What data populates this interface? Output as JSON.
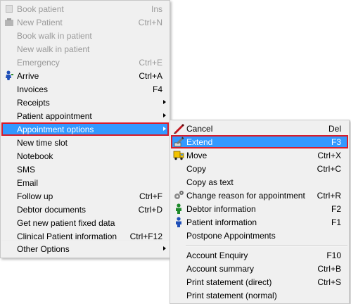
{
  "main_menu": {
    "book_patient": {
      "label": "Book patient",
      "shortcut": "Ins"
    },
    "new_patient": {
      "label": "New Patient",
      "shortcut": "Ctrl+N"
    },
    "book_walk_in": {
      "label": "Book walk in patient"
    },
    "new_walk_in": {
      "label": "New walk in patient"
    },
    "emergency": {
      "label": "Emergency",
      "shortcut": "Ctrl+E"
    },
    "arrive": {
      "label": "Arrive",
      "shortcut": "Ctrl+A"
    },
    "invoices": {
      "label": "Invoices",
      "shortcut": "F4"
    },
    "receipts": {
      "label": "Receipts"
    },
    "patient_appointment": {
      "label": "Patient appointment"
    },
    "appointment_options": {
      "label": "Appointment options"
    },
    "new_time_slot": {
      "label": "New time slot"
    },
    "notebook": {
      "label": "Notebook"
    },
    "sms": {
      "label": "SMS"
    },
    "email": {
      "label": "Email"
    },
    "follow_up": {
      "label": "Follow up",
      "shortcut": "Ctrl+F"
    },
    "debtor_documents": {
      "label": "Debtor documents",
      "shortcut": "Ctrl+D"
    },
    "fixed_data": {
      "label": "Get new patient fixed data"
    },
    "clinical_info": {
      "label": "Clinical Patient information",
      "shortcut": "Ctrl+F12"
    },
    "other_options": {
      "label": "Other Options"
    }
  },
  "sub_menu": {
    "cancel": {
      "label": "Cancel",
      "shortcut": "Del"
    },
    "extend": {
      "label": "Extend",
      "shortcut": "F3"
    },
    "move": {
      "label": "Move",
      "shortcut": "Ctrl+X"
    },
    "copy": {
      "label": "Copy",
      "shortcut": "Ctrl+C"
    },
    "copy_as_text": {
      "label": "Copy as text"
    },
    "change_reason": {
      "label": "Change reason for appointment",
      "shortcut": "Ctrl+R"
    },
    "debtor_information": {
      "label": "Debtor information",
      "shortcut": "F2"
    },
    "patient_information": {
      "label": "Patient information",
      "shortcut": "F1"
    },
    "postpone": {
      "label": "Postpone Appointments"
    },
    "account_enquiry": {
      "label": "Account Enquiry",
      "shortcut": "F10"
    },
    "account_summary": {
      "label": "Account summary",
      "shortcut": "Ctrl+B"
    },
    "print_direct": {
      "label": "Print statement (direct)",
      "shortcut": "Ctrl+S"
    },
    "print_normal": {
      "label": "Print statement (normal)"
    }
  },
  "colors": {
    "highlight": "#3399ff",
    "annotation_box": "#d81c2a",
    "menu_bg": "#f0f0f0",
    "disabled_text": "#9a9a9a"
  }
}
